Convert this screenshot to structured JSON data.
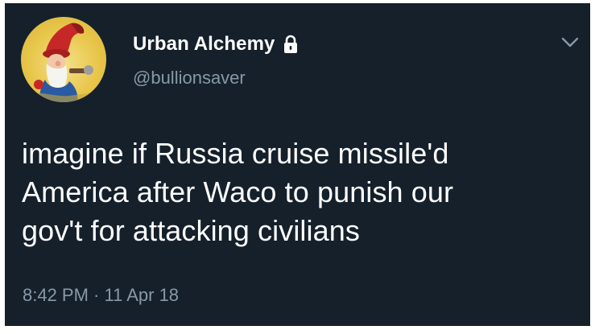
{
  "user": {
    "display_name": "Urban Alchemy",
    "handle": "@bullionsaver",
    "protected_icon": "lock-icon",
    "avatar_icon": "gnome-avatar"
  },
  "menu_icon": "chevron-down-icon",
  "tweet": {
    "lines": [
      "imagine if Russia cruise missile'd",
      "America after Waco to punish our",
      "gov't for attacking civilians"
    ]
  },
  "meta": {
    "timestamp": "8:42 PM · 11 Apr 18"
  },
  "colors": {
    "background": "#15202b",
    "text": "#ffffff",
    "secondary": "#8899a6"
  }
}
